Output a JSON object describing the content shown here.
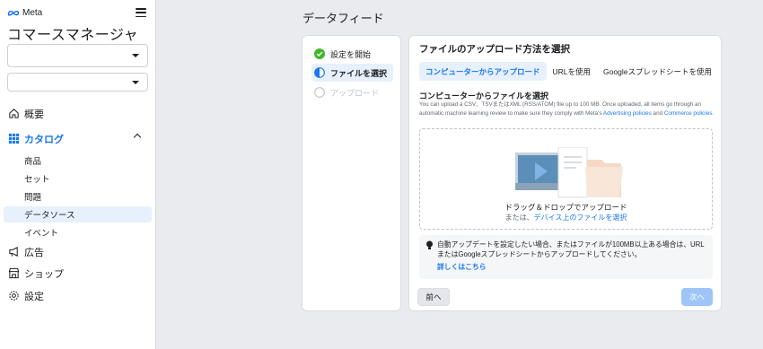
{
  "brand": {
    "logo_text": "Meta",
    "app_name": "コマースマネージャ"
  },
  "sidebar": {
    "select1_value": "",
    "select2_value": "",
    "nav": [
      {
        "label": "概要",
        "icon": "home-icon"
      },
      {
        "label": "カタログ",
        "icon": "grid-icon",
        "active": true
      },
      {
        "label": "広告",
        "icon": "megaphone-icon"
      },
      {
        "label": "ショップ",
        "icon": "shop-icon"
      },
      {
        "label": "設定",
        "icon": "gear-icon"
      }
    ],
    "catalog_sub": [
      "商品",
      "セット",
      "問題",
      "データソース",
      "イベント"
    ],
    "selected_sub": "データソース"
  },
  "page": {
    "title": "データフィード"
  },
  "steps": [
    {
      "label": "設定を開始",
      "state": "done"
    },
    {
      "label": "ファイルを選択",
      "state": "current"
    },
    {
      "label": "アップロード",
      "state": "future"
    }
  ],
  "panel": {
    "title": "ファイルのアップロード方法を選択",
    "tabs": [
      "コンピューターからアップロード",
      "URLを使用",
      "Googleスプレッドシートを使用"
    ],
    "active_tab": 0,
    "section_title": "コンピューターからファイルを選択",
    "desc_prefix": "You can upload a CSV、TSVまたはXML (RSS/ATOM) file up to 100 MB. Once uploaded, all items go through an automatic machine learning review to make sure they comply with Meta's ",
    "desc_link1": "Advertising policies",
    "desc_mid": " and ",
    "desc_link2": "Commerce policies",
    "desc_suffix": ".",
    "drop_label": "ドラッグ＆ドロップでアップロード",
    "drop_or": "または、",
    "drop_link": "デバイス上のファイルを選択",
    "notice_text": "自動アップデートを設定したい場合、またはファイルが100MB以上ある場合は、URLまたはGoogleスプレッドシートからアップロードしてください。",
    "notice_link": "詳しくはこちら",
    "back_label": "前へ",
    "next_label": "次へ"
  },
  "colors": {
    "accent": "#1877f2",
    "success": "#42b72a",
    "next_disabled": "#9ec5f8"
  }
}
